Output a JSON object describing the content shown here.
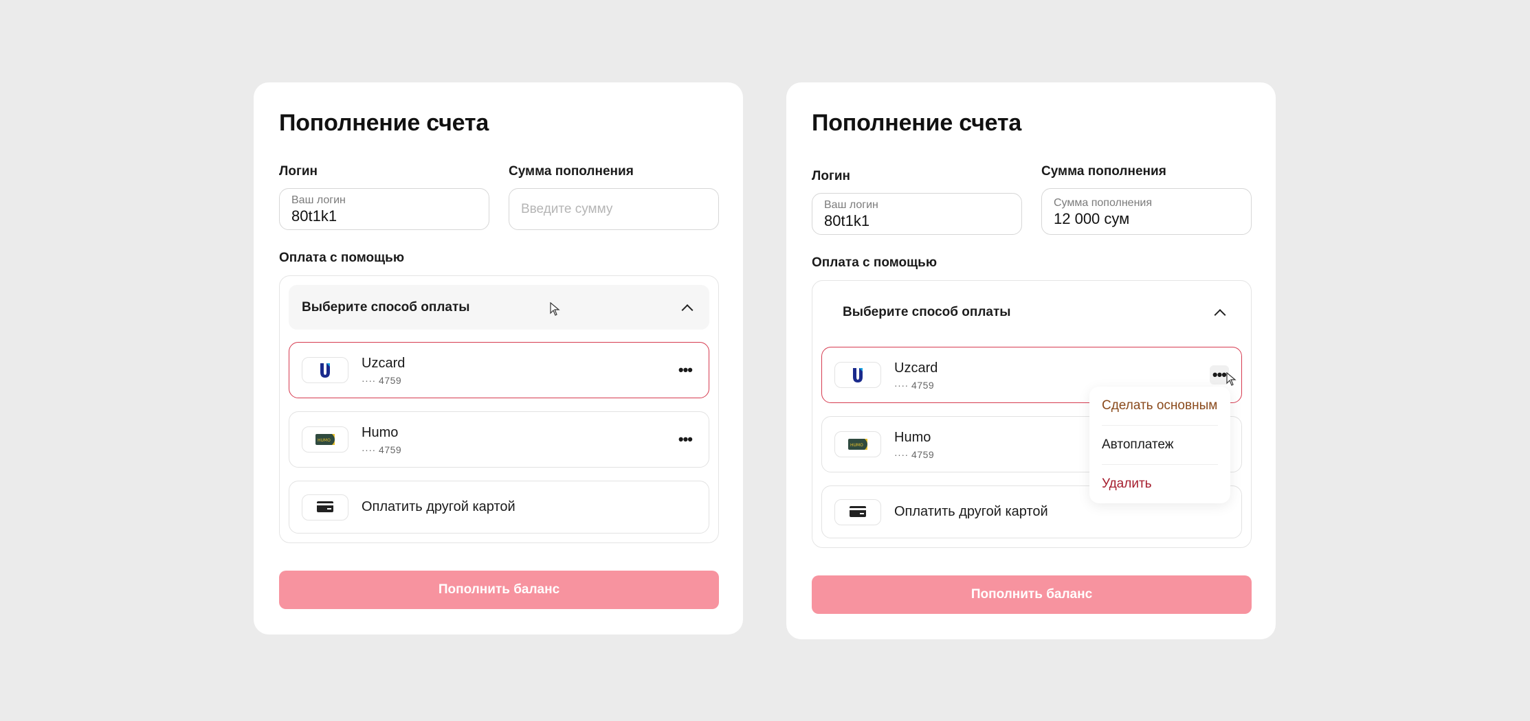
{
  "colors": {
    "background": "#ebebeb",
    "card": "#ffffff",
    "accent_border": "#d63a4f",
    "button_disabled": "#f7939f",
    "make_primary": "#8a4a1c",
    "delete": "#a51d2d"
  },
  "left_card": {
    "title": "Пополнение счета",
    "login": {
      "label": "Логин",
      "placeholder": "Ваш логин",
      "value": "80t1k1"
    },
    "amount": {
      "label": "Сумма пополнения",
      "placeholder": "Введите сумму",
      "value": ""
    },
    "payment_label": "Оплата с помощью",
    "selector_label": "Выберите способ оплаты",
    "cards": [
      {
        "name": "Uzcard",
        "number": "···· 4759",
        "icon": "uzcard-logo",
        "selected": true
      },
      {
        "name": "Humo",
        "number": "···· 4759",
        "icon": "humo-logo",
        "selected": false
      }
    ],
    "other_card": {
      "label": "Оплатить другой картой",
      "icon": "credit-card-icon"
    },
    "submit_label": "Пополнить баланс"
  },
  "right_card": {
    "title": "Пополнение счета",
    "login": {
      "label": "Логин",
      "placeholder": "Ваш логин",
      "value": "80t1k1"
    },
    "amount": {
      "label": "Сумма пополнения",
      "placeholder": "Сумма пополнения",
      "value": "12 000 сум"
    },
    "payment_label": "Оплата с помощью",
    "selector_label": "Выберите способ оплаты",
    "cards": [
      {
        "name": "Uzcard",
        "number": "···· 4759",
        "icon": "uzcard-logo",
        "selected": true
      },
      {
        "name": "Humo",
        "number": "···· 4759",
        "icon": "humo-logo",
        "selected": false
      }
    ],
    "other_card": {
      "label": "Оплатить другой картой",
      "icon": "credit-card-icon"
    },
    "submit_label": "Пополнить баланс",
    "context_menu": {
      "items": [
        {
          "label": "Сделать основным",
          "color": "#8a4a1c"
        },
        {
          "label": "Автоплатеж",
          "color": "#1a1a1a"
        },
        {
          "label": "Удалить",
          "color": "#a51d2d"
        }
      ]
    }
  },
  "humo_logo_text": "HUMO"
}
